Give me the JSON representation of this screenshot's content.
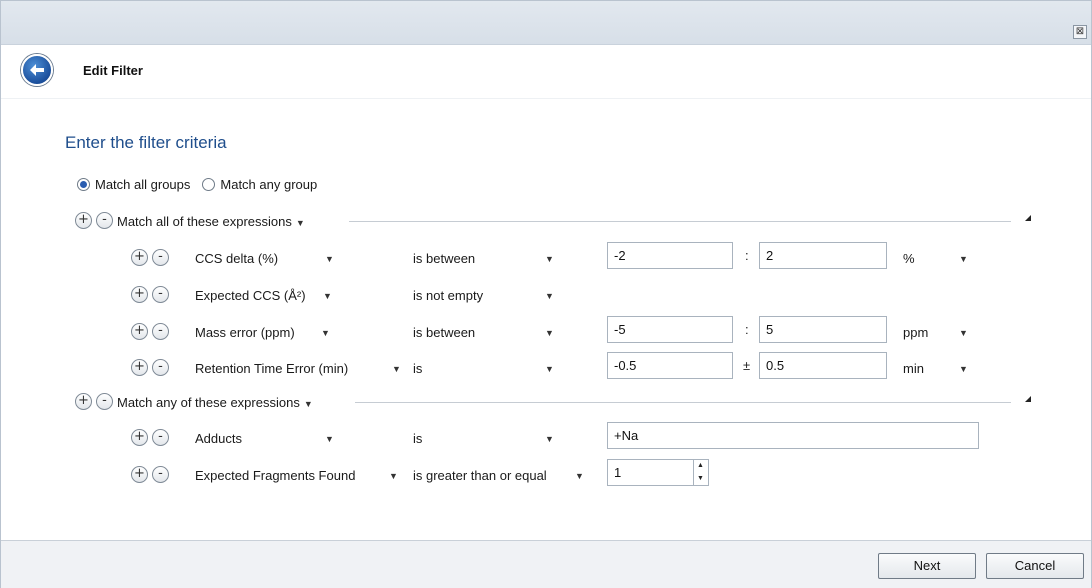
{
  "window": {
    "close_glyph": "⊠"
  },
  "header": {
    "title": "Edit Filter",
    "back_icon": "back-arrow-icon"
  },
  "section_title": "Enter the filter criteria",
  "match_mode": {
    "options": [
      "Match all groups",
      "Match any group"
    ],
    "selected": "Match all groups"
  },
  "groups": [
    {
      "label": "Match all of these expressions",
      "rows": [
        {
          "field": "CCS delta (%)",
          "operator": "is between",
          "value1": "-2",
          "separator": ":",
          "value2": "2",
          "unit": "%"
        },
        {
          "field": "Expected CCS (Å²)",
          "operator": "is not empty"
        },
        {
          "field": "Mass error (ppm)",
          "operator": "is between",
          "value1": "-5",
          "separator": ":",
          "value2": "5",
          "unit": "ppm"
        },
        {
          "field": "Retention Time Error (min)",
          "operator": "is",
          "value1": "-0.5",
          "separator": "±",
          "value2": "0.5",
          "unit": "min"
        }
      ]
    },
    {
      "label": "Match any of these expressions",
      "rows": [
        {
          "field": "Adducts",
          "operator": "is",
          "value1": "+Na"
        },
        {
          "field": "Expected Fragments Found",
          "operator": "is greater than or equal",
          "value1": "1"
        }
      ]
    }
  ],
  "buttons": {
    "plus": "+",
    "minus": "-",
    "next": "Next",
    "cancel": "Cancel"
  }
}
